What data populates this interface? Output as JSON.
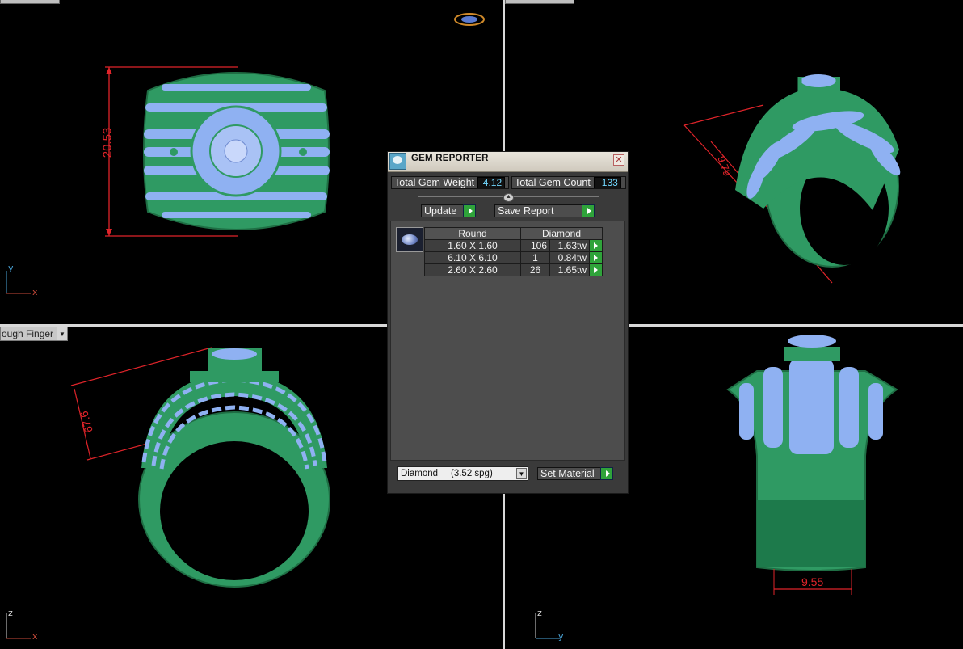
{
  "viewports": {
    "top_left": {
      "dimension_value": "20.53",
      "axis_v": "y",
      "axis_h": "x"
    },
    "top_right": {
      "dimension_value": "9.79"
    },
    "bottom_left": {
      "view_label": "ough Finger",
      "dimension_value": "67.6",
      "axis_v": "z",
      "axis_h": "x"
    },
    "bottom_right": {
      "dimension_value": "9.55",
      "axis_v": "z",
      "axis_h": "y"
    }
  },
  "colors": {
    "ring_green": "#2f9a63",
    "gem_blue": "#8fb1f2",
    "dimension_red": "#e0242a",
    "axis_x": "#c84a3a",
    "axis_y": "#4aa4d8",
    "axis_z": "#d8d8d8"
  },
  "gem_reporter": {
    "title": "GEM REPORTER",
    "close_icon": "close-icon",
    "total_gem_weight_label": "Total Gem Weight",
    "total_gem_weight_value": "4.12",
    "total_gem_count_label": "Total Gem Count",
    "total_gem_count_value": "133",
    "update_label": "Update",
    "save_report_label": "Save Report",
    "table": {
      "shape": "Round",
      "material": "Diamond",
      "rows": [
        {
          "size": "1.60 X 1.60",
          "count": "106",
          "weight": "1.63tw"
        },
        {
          "size": "6.10 X 6.10",
          "count": "1",
          "weight": "0.84tw"
        },
        {
          "size": "2.60 X 2.60",
          "count": "26",
          "weight": "1.65tw"
        }
      ]
    },
    "material_select_value": "Diamond     (3.52 spg)",
    "set_material_label": "Set Material"
  }
}
